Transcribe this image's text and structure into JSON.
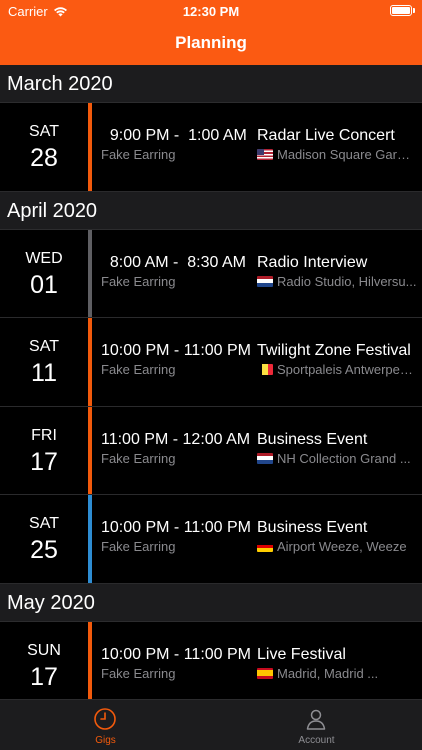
{
  "status": {
    "carrier": "Carrier",
    "time": "12:30 PM",
    "battery_level": 1.0
  },
  "nav": {
    "title": "Planning"
  },
  "colors": {
    "header": "#fb5a12",
    "orange": "#f25a0c",
    "gray": "#5f5f63",
    "blue": "#2e8dd3"
  },
  "sections": [
    {
      "title": "March 2020",
      "gigs": [
        {
          "dow": "SAT",
          "day": "28",
          "time": "  9:00 PM -  1:00 AM",
          "artist": "Fake Earring",
          "event": "Radar Live Concert",
          "location": "Madison Square Garde...",
          "flag": "us-flag-icon",
          "accent": "orange"
        }
      ]
    },
    {
      "title": "April 2020",
      "gigs": [
        {
          "dow": "WED",
          "day": "01",
          "time": "  8:00 AM -  8:30 AM",
          "artist": "Fake Earring",
          "event": "Radio Interview",
          "location": "Radio Studio, Hilversu...",
          "flag": "nl-flag-icon",
          "accent": "gray"
        },
        {
          "dow": "SAT",
          "day": "11",
          "time": "10:00 PM - 11:00 PM",
          "artist": "Fake Earring",
          "event": "Twilight Zone Festival",
          "location": "Sportpaleis Antwerpen...",
          "flag": "be-flag-icon",
          "accent": "orange"
        },
        {
          "dow": "FRI",
          "day": "17",
          "time": "11:00 PM - 12:00 AM",
          "artist": "Fake Earring",
          "event": "Business Event",
          "location": "NH Collection Grand ...",
          "flag": "nl-flag-icon",
          "accent": "orange"
        },
        {
          "dow": "SAT",
          "day": "25",
          "time": "10:00 PM - 11:00 PM",
          "artist": "Fake Earring",
          "event": "Business Event",
          "location": "Airport Weeze, Weeze",
          "flag": "de-flag-icon",
          "accent": "blue"
        }
      ]
    },
    {
      "title": "May 2020",
      "gigs": [
        {
          "dow": "SUN",
          "day": "17",
          "time": "10:00 PM - 11:00 PM",
          "artist": "Fake Earring",
          "event": "Live Festival",
          "location": "Madrid, Madrid   ...",
          "flag": "es-flag-icon",
          "accent": "orange"
        }
      ]
    }
  ],
  "tabs": [
    {
      "label": "Gigs",
      "icon": "clock-icon",
      "active": true
    },
    {
      "label": "Account",
      "icon": "person-icon",
      "active": false
    }
  ]
}
